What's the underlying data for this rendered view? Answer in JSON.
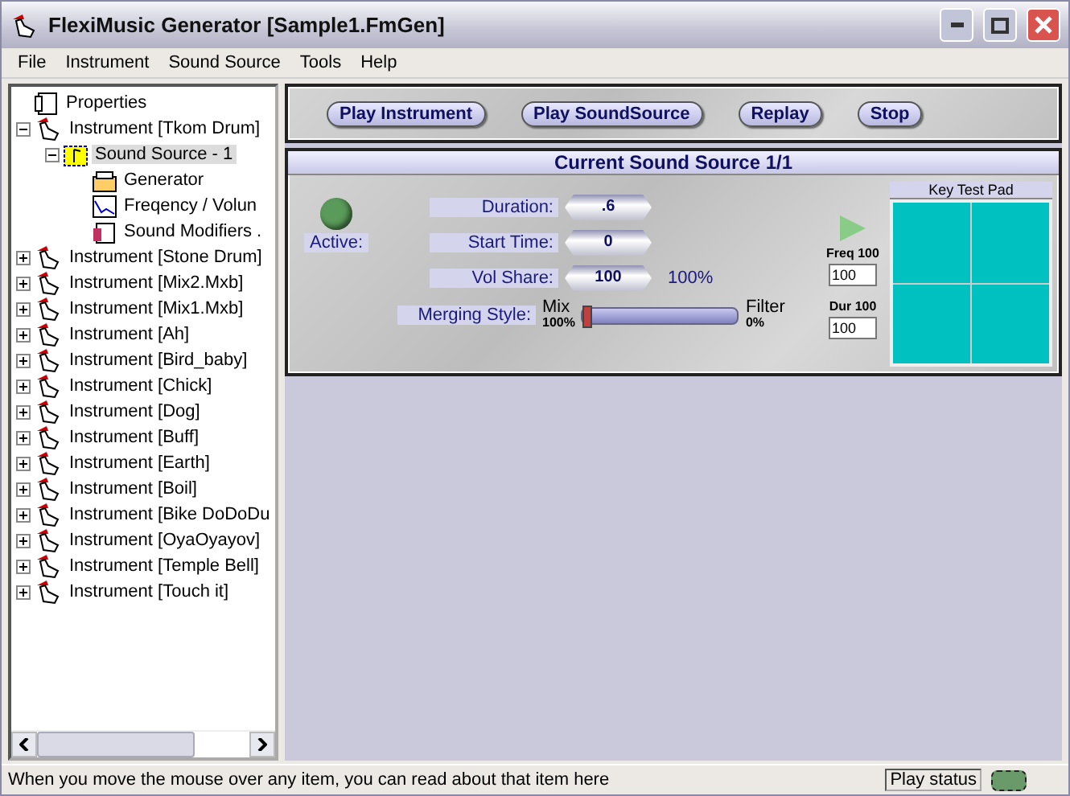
{
  "window": {
    "title": "FlexiMusic Generator [Sample1.FmGen]"
  },
  "menu": [
    "File",
    "Instrument",
    "Sound Source",
    "Tools",
    "Help"
  ],
  "tree": [
    {
      "kind": "properties",
      "label": "Properties",
      "selected": false
    },
    {
      "kind": "instrument",
      "label": "Instrument [Tkom Drum]",
      "selected": false,
      "expanded": true,
      "children": [
        {
          "kind": "source",
          "label": "Sound Source - 1",
          "selected": true,
          "expanded": true,
          "children": [
            {
              "kind": "generator",
              "label": "Generator",
              "selected": false
            },
            {
              "kind": "frequency",
              "label": "Freqency / Volun",
              "selected": false
            },
            {
              "kind": "modifiers",
              "label": "Sound Modifiers .",
              "selected": false
            }
          ]
        }
      ]
    },
    {
      "kind": "instrument",
      "label": "Instrument [Stone Drum]",
      "selected": false,
      "expanded": false
    },
    {
      "kind": "instrument",
      "label": "Instrument [Mix2.Mxb]",
      "selected": false,
      "expanded": false
    },
    {
      "kind": "instrument",
      "label": "Instrument [Mix1.Mxb]",
      "selected": false,
      "expanded": false
    },
    {
      "kind": "instrument",
      "label": "Instrument [Ah]",
      "selected": false,
      "expanded": false
    },
    {
      "kind": "instrument",
      "label": "Instrument [Bird_baby]",
      "selected": false,
      "expanded": false
    },
    {
      "kind": "instrument",
      "label": "Instrument [Chick]",
      "selected": false,
      "expanded": false
    },
    {
      "kind": "instrument",
      "label": "Instrument [Dog]",
      "selected": false,
      "expanded": false
    },
    {
      "kind": "instrument",
      "label": "Instrument [Buff]",
      "selected": false,
      "expanded": false
    },
    {
      "kind": "instrument",
      "label": "Instrument [Earth]",
      "selected": false,
      "expanded": false
    },
    {
      "kind": "instrument",
      "label": "Instrument [Boil]",
      "selected": false,
      "expanded": false
    },
    {
      "kind": "instrument",
      "label": "Instrument [Bike DoDoDu",
      "selected": false,
      "expanded": false
    },
    {
      "kind": "instrument",
      "label": "Instrument [OyaOyayov]",
      "selected": false,
      "expanded": false
    },
    {
      "kind": "instrument",
      "label": "Instrument [Temple Bell]",
      "selected": false,
      "expanded": false
    },
    {
      "kind": "instrument",
      "label": "Instrument [Touch it]",
      "selected": false,
      "expanded": false
    }
  ],
  "toolbar": [
    "Play Instrument",
    "Play SoundSource",
    "Replay",
    "Stop"
  ],
  "source_panel": {
    "title": "Current Sound Source 1/1",
    "active_label": "Active:",
    "fields": [
      {
        "label": "Duration:",
        "value": ".6"
      },
      {
        "label": "Start Time:",
        "value": "0"
      },
      {
        "label": "Vol Share:",
        "value": "100",
        "note": "100%"
      }
    ],
    "merging": {
      "label": "Merging Style:",
      "left": "Mix",
      "left_value": "100%",
      "right": "Filter",
      "right_value": "0%",
      "level": 0
    },
    "key_pad": {
      "title": "Key Test Pad",
      "freq_label": "Freq",
      "freq_reading": "100",
      "freq_value": "100",
      "dur_label": "Dur",
      "dur_reading": "100",
      "dur_value": "100"
    }
  },
  "status_bar": {
    "message": "When you move the mouse over any item, you can read about that item here",
    "play_status": "Play status"
  }
}
